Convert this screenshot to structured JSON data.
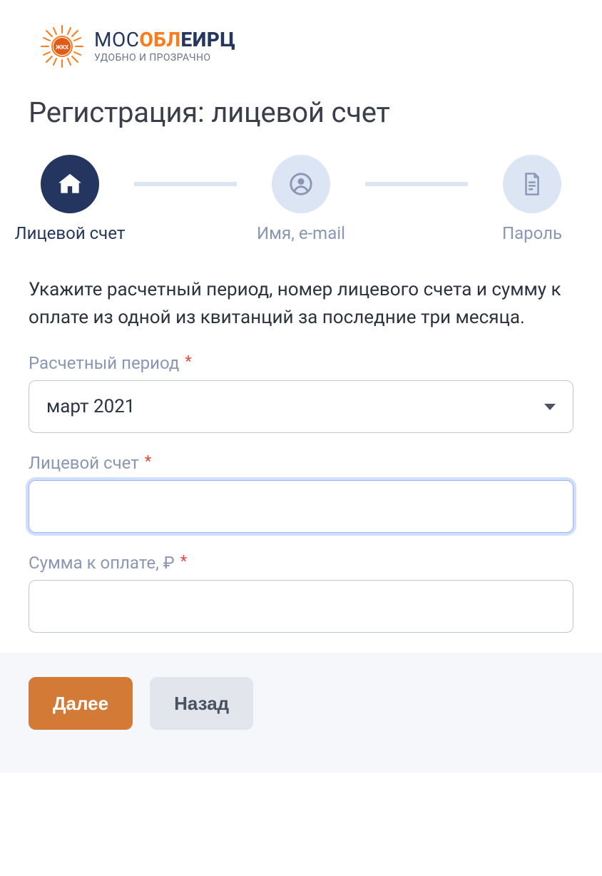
{
  "logo": {
    "brand_plain1": "МОС",
    "brand_accent": "ОБЛ",
    "brand_plain2": "ЕИРЦ",
    "sub": "УДОБНО И ПРОЗРАЧНО"
  },
  "title": "Регистрация: лицевой счет",
  "stepper": {
    "step1": {
      "label": "Лицевой счет",
      "active": true
    },
    "step2": {
      "label": "Имя, e-mail",
      "active": false
    },
    "step3": {
      "label": "Пароль",
      "active": false
    }
  },
  "intro": "Укажите расчетный период, номер лицевого счета и сумму к оплате из одной из квитанций за последние три месяца.",
  "fields": {
    "period": {
      "label": "Расчетный период",
      "value": "март 2021"
    },
    "account": {
      "label": "Лицевой счет",
      "value": ""
    },
    "amount": {
      "label": "Сумма к оплате, ₽",
      "value": ""
    }
  },
  "required_mark": "*",
  "buttons": {
    "next": "Далее",
    "back": "Назад"
  }
}
